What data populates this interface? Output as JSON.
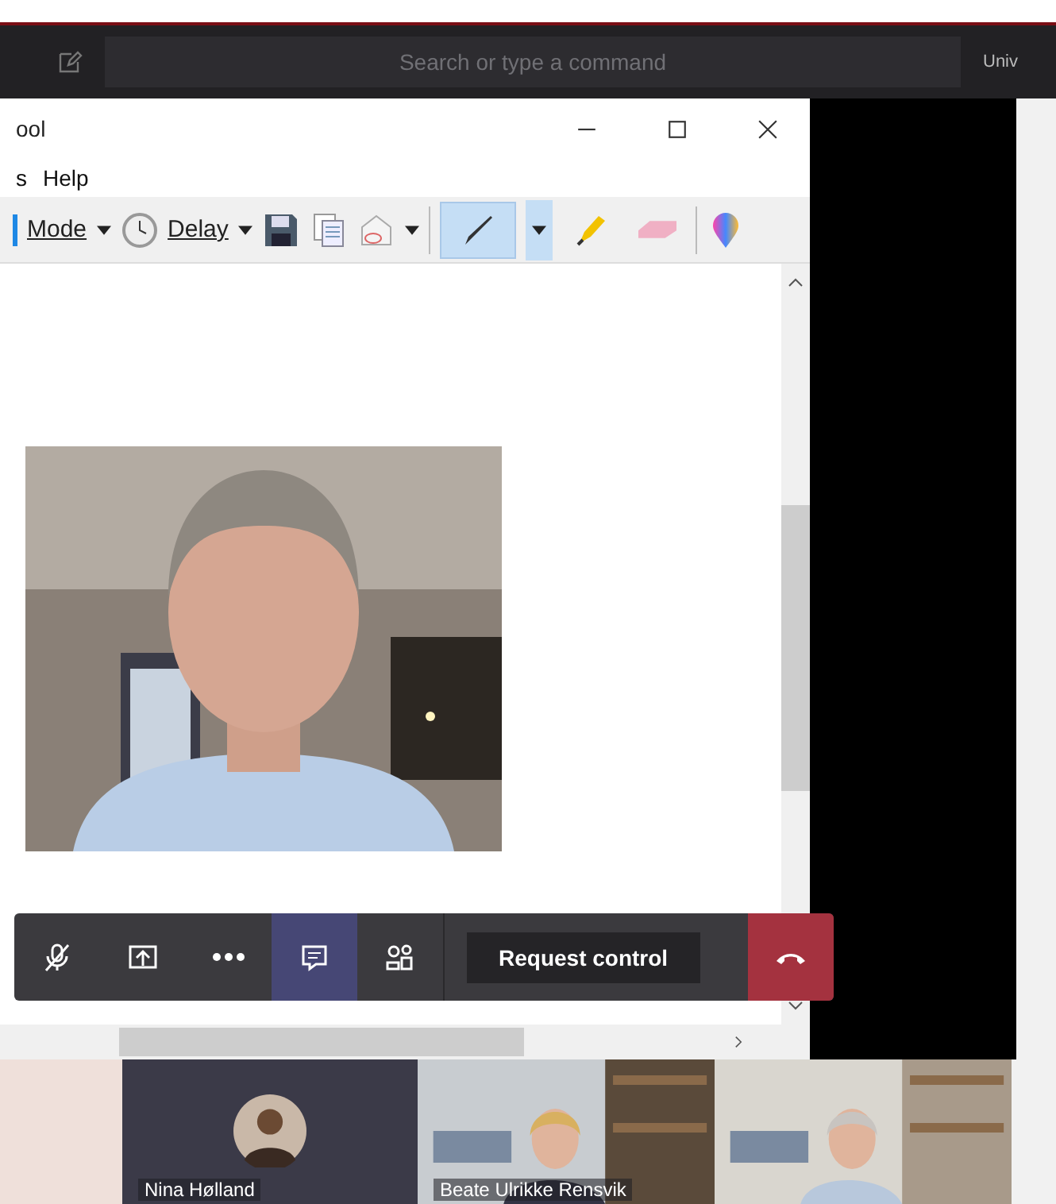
{
  "top_bar": {
    "search": {
      "placeholder": "Search or type a command"
    },
    "org_label": "Univ"
  },
  "snip_window": {
    "title": "ool",
    "menu": [
      "s",
      "Help"
    ],
    "mode_label": "Mode",
    "delay_label": "Delay",
    "tools": [
      {
        "kind": "pen",
        "selected": true
      },
      {
        "kind": "highlighter",
        "selected": false
      },
      {
        "kind": "eraser",
        "selected": false
      }
    ]
  },
  "call_bar": {
    "buttons": [
      {
        "kind": "mic-off",
        "selected": false
      },
      {
        "kind": "share",
        "selected": false
      },
      {
        "kind": "more",
        "selected": false
      },
      {
        "kind": "chat",
        "selected": true
      },
      {
        "kind": "people",
        "selected": false
      }
    ],
    "request_control": "Request control"
  },
  "participants": [
    {
      "kind": "blank"
    },
    {
      "kind": "avatar",
      "name": "Nina Hølland"
    },
    {
      "kind": "video",
      "name": "Beate Ulrikke Rensvik"
    },
    {
      "kind": "video"
    }
  ]
}
